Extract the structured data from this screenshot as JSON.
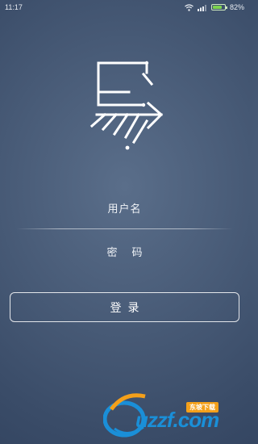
{
  "status_bar": {
    "time": "11:17",
    "battery_percent": "82%",
    "battery_level": 0.82
  },
  "form": {
    "username_placeholder": "用户名",
    "password_placeholder": "密码",
    "login_label": "登录"
  },
  "watermark": {
    "site": "uzzf.com",
    "badge": "东坡下载"
  },
  "colors": {
    "background": "#4a5d79",
    "battery": "#7dd34e",
    "watermark_blue": "#1a8fd8",
    "watermark_orange": "#f4a01a"
  }
}
